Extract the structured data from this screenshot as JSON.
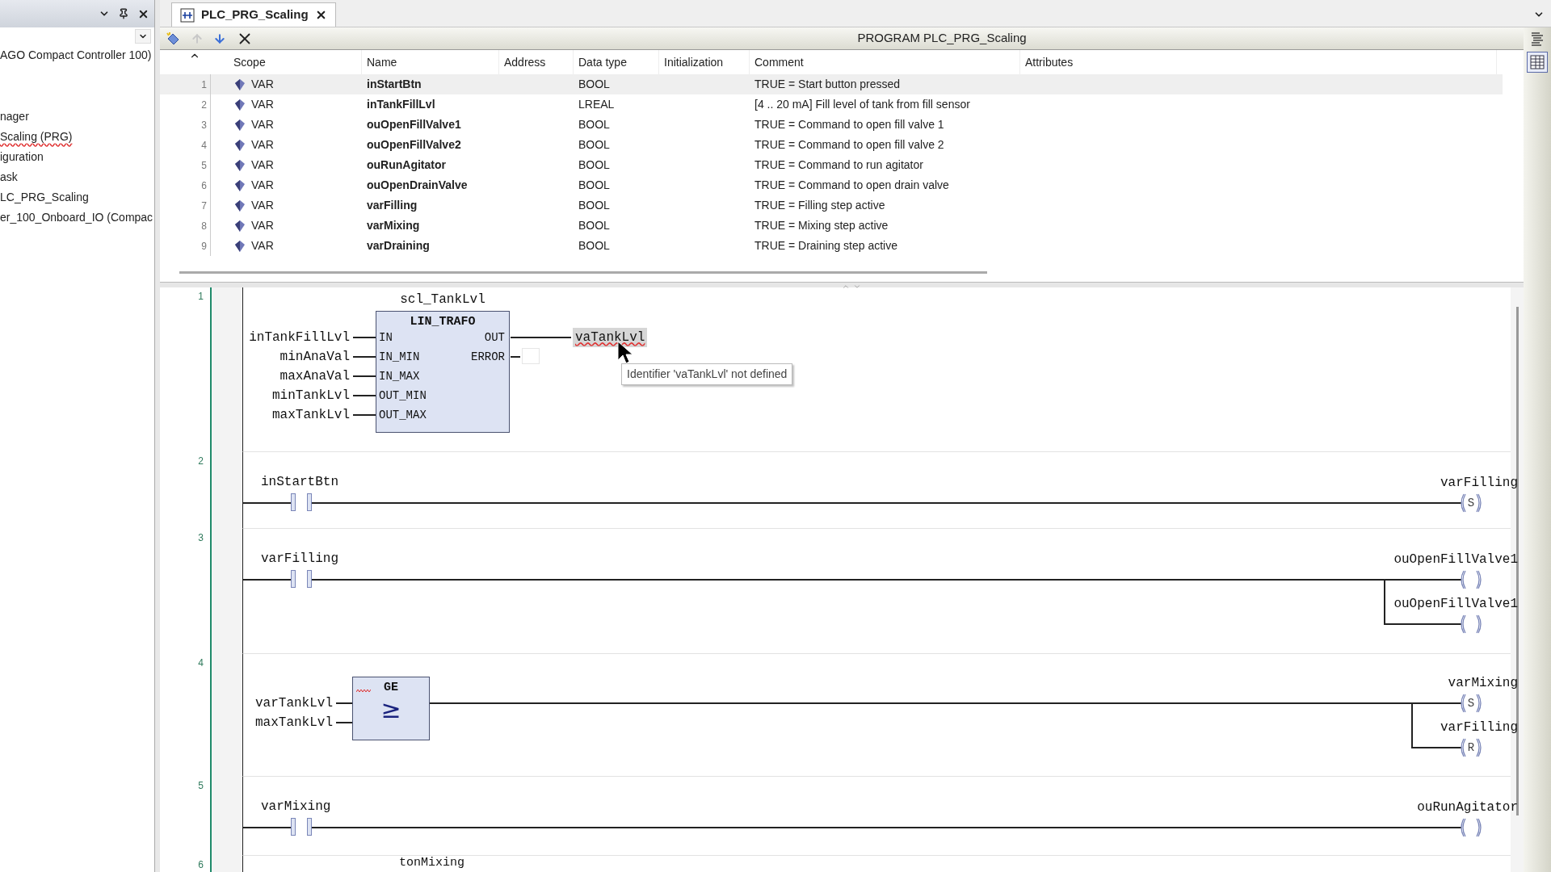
{
  "sidebar": {
    "items": [
      {
        "label": "AGO Compact Controller 100)",
        "misspelled": false
      },
      {
        "label": "nager",
        "misspelled": false
      },
      {
        "label": "Scaling (PRG)",
        "misspelled": true
      },
      {
        "label": "iguration",
        "misspelled": false
      },
      {
        "label": "ask",
        "misspelled": false
      },
      {
        "label": "LC_PRG_Scaling",
        "misspelled": false
      },
      {
        "label": "er_100_Onboard_IO (Compac",
        "misspelled": false
      }
    ]
  },
  "tab": {
    "title": "PLC_PRG_Scaling",
    "selected": true
  },
  "editor_title": "PROGRAM PLC_PRG_Scaling",
  "table": {
    "columns": [
      "Scope",
      "Name",
      "Address",
      "Data type",
      "Initialization",
      "Comment",
      "Attributes"
    ],
    "rows": [
      {
        "line": "1",
        "scope": "VAR",
        "name": "inStartBtn",
        "data_type": "BOOL",
        "comment": "TRUE = Start button pressed",
        "selected": true
      },
      {
        "line": "2",
        "scope": "VAR",
        "name": "inTankFillLvl",
        "data_type": "LREAL",
        "comment": "[4 .. 20 mA] Fill level of tank from fill sensor",
        "selected": false
      },
      {
        "line": "3",
        "scope": "VAR",
        "name": "ouOpenFillValve1",
        "data_type": "BOOL",
        "comment": "TRUE = Command to open fill valve 1",
        "selected": false
      },
      {
        "line": "4",
        "scope": "VAR",
        "name": "ouOpenFillValve2",
        "data_type": "BOOL",
        "comment": "TRUE = Command to open fill valve 2",
        "selected": false
      },
      {
        "line": "5",
        "scope": "VAR",
        "name": "ouRunAgitator",
        "data_type": "BOOL",
        "comment": "TRUE = Command to run agitator",
        "selected": false
      },
      {
        "line": "6",
        "scope": "VAR",
        "name": "ouOpenDrainValve",
        "data_type": "BOOL",
        "comment": "TRUE = Command to open drain valve",
        "selected": false
      },
      {
        "line": "7",
        "scope": "VAR",
        "name": "varFilling",
        "data_type": "BOOL",
        "comment": "TRUE = Filling step active",
        "selected": false
      },
      {
        "line": "8",
        "scope": "VAR",
        "name": "varMixing",
        "data_type": "BOOL",
        "comment": "TRUE = Mixing step active",
        "selected": false
      },
      {
        "line": "9",
        "scope": "VAR",
        "name": "varDraining",
        "data_type": "BOOL",
        "comment": "TRUE = Draining step active",
        "selected": false
      }
    ]
  },
  "ladder": {
    "networks": [
      {
        "number": "1",
        "kind": "function_block",
        "instance": "scl_TankLvl",
        "block": "LIN_TRAFO",
        "inputs": [
          {
            "pin": "IN",
            "variable": "inTankFillLvl"
          },
          {
            "pin": "IN_MIN",
            "variable": "minAnaVal"
          },
          {
            "pin": "IN_MAX",
            "variable": "maxAnaVal"
          },
          {
            "pin": "OUT_MIN",
            "variable": "minTankLvl"
          },
          {
            "pin": "OUT_MAX",
            "variable": "maxTankLvl"
          }
        ],
        "outputs": [
          {
            "pin": "OUT",
            "variable": "vaTankLvl",
            "error": true
          },
          {
            "pin": "ERROR"
          }
        ],
        "tooltip": "Identifier 'vaTankLvl' not defined"
      },
      {
        "number": "2",
        "kind": "contact",
        "contact": "inStartBtn",
        "coils": [
          {
            "variable": "varFilling",
            "symbol": "S"
          }
        ]
      },
      {
        "number": "3",
        "kind": "contact",
        "contact": "varFilling",
        "coils": [
          {
            "variable": "ouOpenFillValve1"
          },
          {
            "variable": "ouOpenFillValve1"
          }
        ]
      },
      {
        "number": "4",
        "kind": "compare",
        "block": "GE",
        "symbol": "≥",
        "error": true,
        "inputs": [
          "varTankLvl",
          "maxTankLvl"
        ],
        "coils": [
          {
            "variable": "varMixing",
            "symbol": "S"
          },
          {
            "variable": "varFilling",
            "symbol": "R"
          }
        ]
      },
      {
        "number": "5",
        "kind": "contact",
        "contact": "varMixing",
        "coils": [
          {
            "variable": "ouRunAgitator"
          }
        ]
      },
      {
        "number": "6",
        "kind": "partial",
        "instance": "tonMixing"
      }
    ]
  }
}
